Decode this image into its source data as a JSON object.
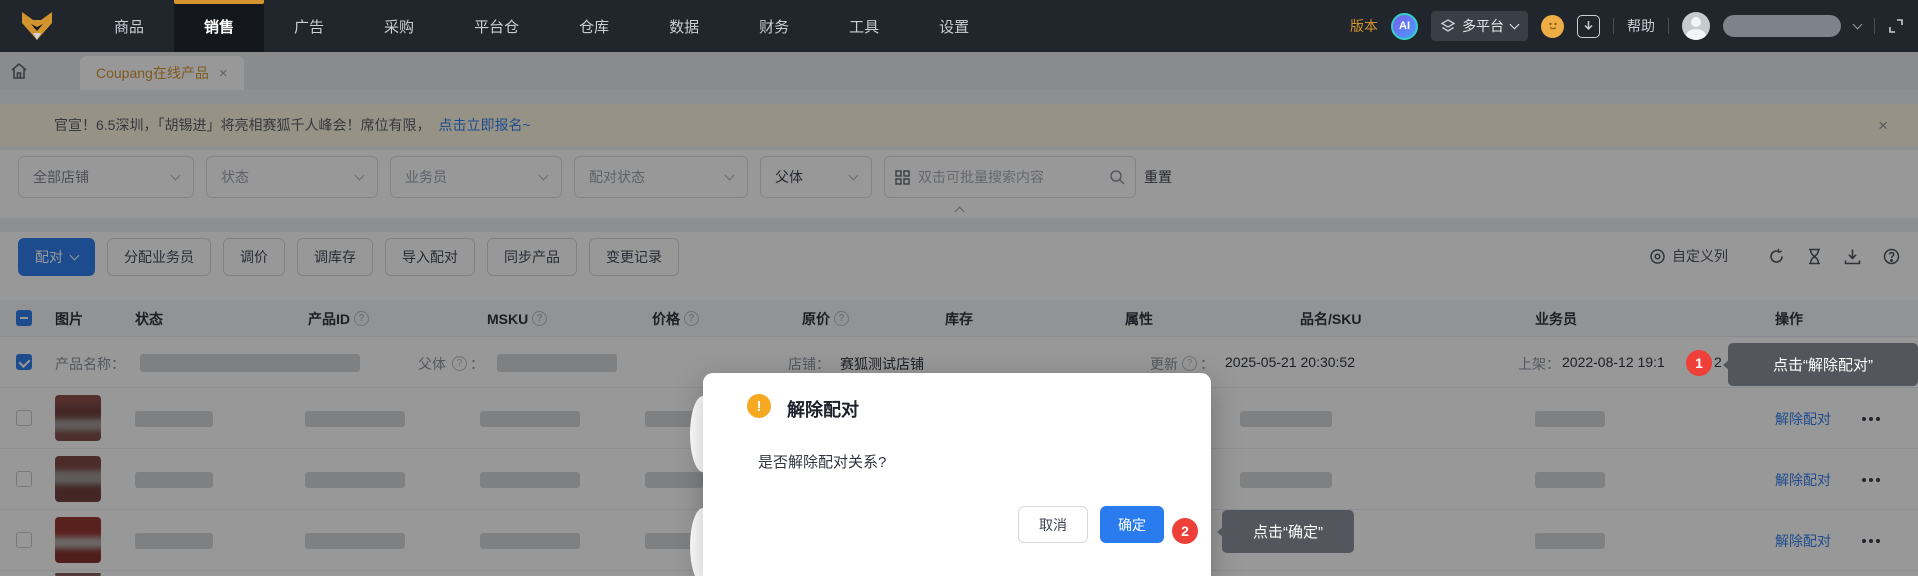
{
  "nav": {
    "items": [
      "商品",
      "销售",
      "广告",
      "采购",
      "平台仓",
      "仓库",
      "数据",
      "财务",
      "工具",
      "设置"
    ],
    "active_item": "销售",
    "version": "版本",
    "ai_badge": "AI",
    "platform": "多平台",
    "help": "帮助"
  },
  "tabs": {
    "active": "Coupang在线产品",
    "close": "×"
  },
  "banner": {
    "text": "官宣！6.5深圳，「胡锡进」将亮相赛狐千人峰会！席位有限，",
    "link": "点击立即报名~",
    "close": "×"
  },
  "filters": {
    "shop": "全部店铺",
    "status": "状态",
    "salesman": "业务员",
    "pair_status": "配对状态",
    "parent": "父体",
    "search_placeholder": "双击可批量搜索内容",
    "reset": "重置"
  },
  "toolbar": {
    "pair": "配对",
    "buttons": [
      "分配业务员",
      "调价",
      "调库存",
      "导入配对",
      "同步产品",
      "变更记录"
    ],
    "customize": "自定义列"
  },
  "table": {
    "headers": [
      "图片",
      "状态",
      "产品ID",
      "MSKU",
      "价格",
      "原价",
      "库存",
      "属性",
      "品名/SKU",
      "业务员",
      "操作"
    ],
    "qmark": "?",
    "parent_row": {
      "name_label": "产品名称：",
      "parent_label": "父体",
      "colon": "：",
      "shop_label": "店铺：",
      "shop_value": "赛狐测试店铺",
      "update_label": "更新",
      "update_value": "2025-05-21 20:30:52",
      "listed_label": "上架：",
      "listed_value": "2022-08-12 19:1",
      "listed_tail": "2"
    },
    "action_label": "解除配对"
  },
  "modal": {
    "title": "解除配对",
    "body": "是否解除配对关系?",
    "cancel": "取消",
    "ok": "确定",
    "warn_mark": "!"
  },
  "steps": {
    "one": {
      "num": "1",
      "tip": "点击“解除配对”"
    },
    "two": {
      "num": "2",
      "tip": "点击“确定”"
    }
  },
  "colors": {
    "accent": "#2a7cee",
    "nav_orange": "#d2942f",
    "danger": "#ee3f38",
    "warning": "#f6a821",
    "link": "#2e7ef0"
  }
}
